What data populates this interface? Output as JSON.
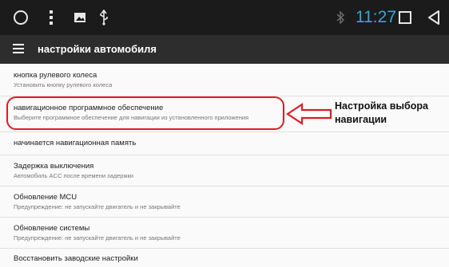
{
  "status_bar": {
    "time": "11:27",
    "icons": [
      "home-circle-icon",
      "more-vert-icon",
      "image-icon",
      "usb-icon",
      "bluetooth-icon",
      "recents-square-icon",
      "back-triangle-icon"
    ],
    "time_color": "#36a7d8"
  },
  "app_bar": {
    "title": "настройки автомобиля"
  },
  "settings": [
    {
      "title": "кнопка рулевого колеса",
      "subtitle": "Установить кнопку рулевого колеса"
    },
    {
      "title": "навигационное программное обеспечение",
      "subtitle": "Выберите программное обеспечение для навигации из установленного приложения"
    },
    {
      "title": "начинается навигационная память",
      "subtitle": ""
    },
    {
      "title": "Задержка выключения",
      "subtitle": "Автомобиль ACC после времени задержки"
    },
    {
      "title": "Обновление MCU",
      "subtitle": "Предупреждение: не запускайте двигатель и не закрывайте"
    },
    {
      "title": "Обновление системы",
      "subtitle": "Предупреждение: не запускайте двигатель и не закрывайте"
    },
    {
      "title": "Восстановить заводские настройки",
      "subtitle": ""
    }
  ],
  "annotation": {
    "text": "Настройка выбора навигации",
    "color": "#e01b24"
  }
}
